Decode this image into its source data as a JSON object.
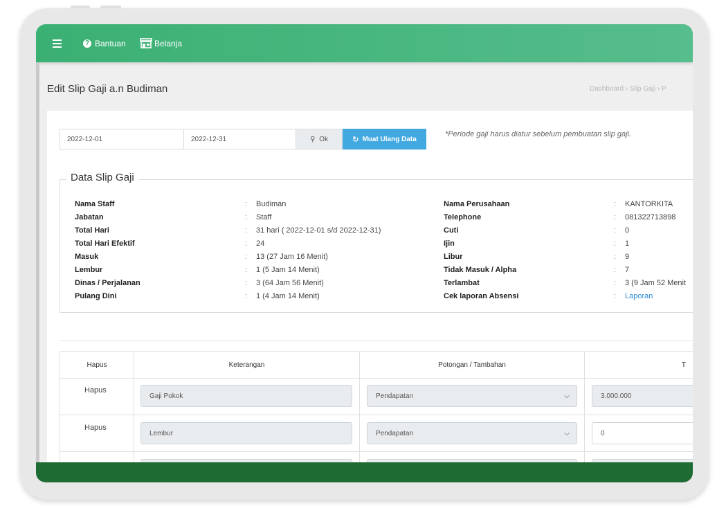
{
  "navbar": {
    "help_label": "Bantuan",
    "shop_label": "Belanja"
  },
  "page": {
    "title": "Edit Slip Gaji a.n Budiman",
    "breadcrumb": [
      "Dashboard",
      "Slip Gaji",
      "P"
    ]
  },
  "period": {
    "start": "2022-12-01",
    "end": "2022-12-31",
    "ok_label": "Ok",
    "reload_label": "Muat Ulang Data",
    "note": "*Periode gaji harus diatur sebelum pembuatan slip gaji."
  },
  "slip": {
    "legend": "Data Slip Gaji",
    "left": [
      {
        "label": "Nama Staff",
        "value": "Budiman"
      },
      {
        "label": "Jabatan",
        "value": "Staff"
      },
      {
        "label": "Total Hari",
        "value": "31 hari ( 2022-12-01 s/d 2022-12-31)"
      },
      {
        "label": "Total Hari Efektif",
        "value": "24"
      },
      {
        "label": "Masuk",
        "value": "13 (27 Jam 16 Menit)"
      },
      {
        "label": "Lembur",
        "value": "1 (5 Jam 14 Menit)"
      },
      {
        "label": "Dinas / Perjalanan",
        "value": "3 (64 Jam 56 Menit)"
      },
      {
        "label": "Pulang Dini",
        "value": "1 (4 Jam 14 Menit)"
      }
    ],
    "right": [
      {
        "label": "Nama Perusahaan",
        "value": "KANTORKITA"
      },
      {
        "label": "Telephone",
        "value": "081322713898"
      },
      {
        "label": "Cuti",
        "value": "0"
      },
      {
        "label": "Ijin",
        "value": "1"
      },
      {
        "label": "Libur",
        "value": "9"
      },
      {
        "label": "Tidak Masuk / Alpha",
        "value": "7"
      },
      {
        "label": "Terlambat",
        "value": "3 (9 Jam 52 Menit"
      },
      {
        "label": "Cek laporan Absensi",
        "value": "Laporan"
      }
    ]
  },
  "table": {
    "headers": [
      "Hapus",
      "Keterangan",
      "Potongan / Tambahan",
      "T"
    ],
    "rows": [
      {
        "delete": "Hapus",
        "keterangan": "Gaji Pokok",
        "type": "Pendapatan",
        "amount": "3.000.000"
      },
      {
        "delete": "Hapus",
        "keterangan": "Lembur",
        "type": "Pendapatan",
        "amount": "0"
      }
    ]
  },
  "colors": {
    "navbar": "#3bb073",
    "button_blue": "#41a9e0",
    "footer": "#1e6b33"
  }
}
